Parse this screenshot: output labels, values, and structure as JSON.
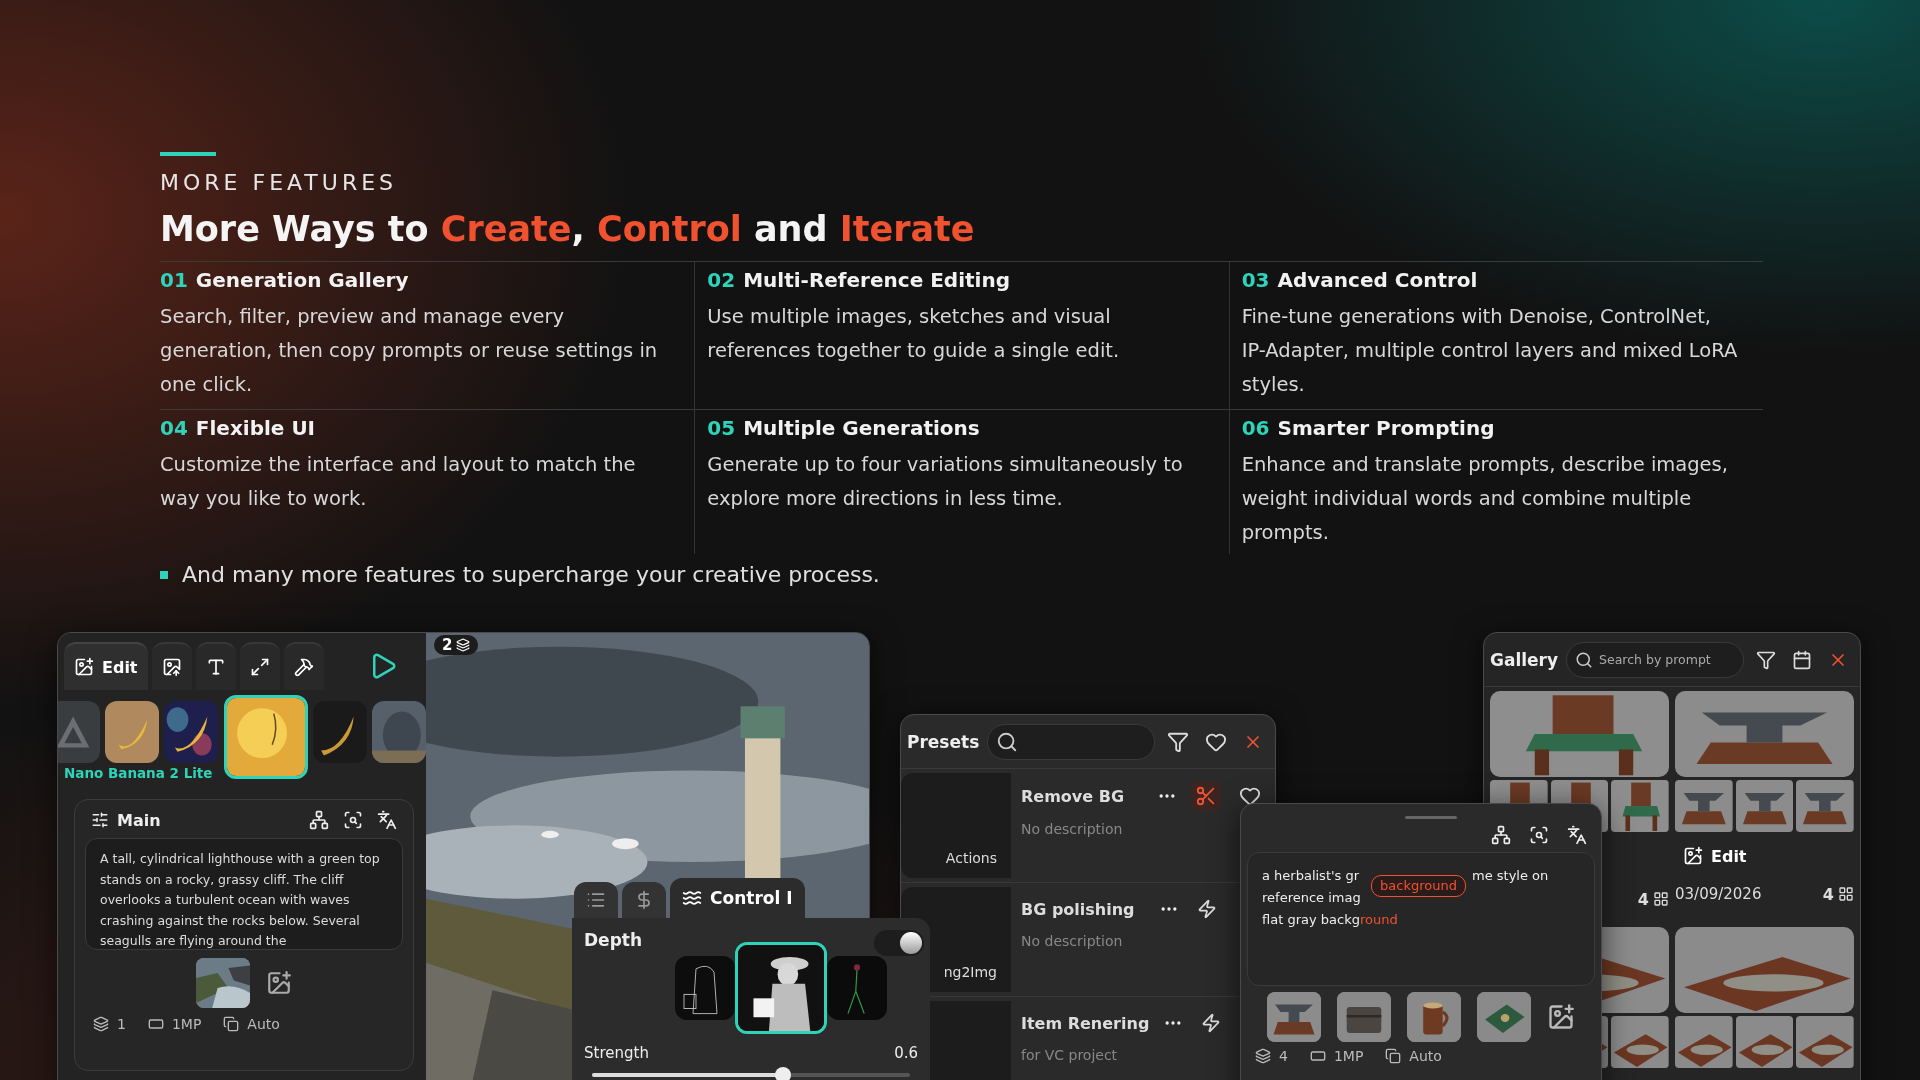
{
  "section_label": "MORE FEATURES",
  "heading": [
    {
      "text": "More Ways to ",
      "accent": false
    },
    {
      "text": "Create",
      "accent": true
    },
    {
      "text": ", ",
      "accent": false
    },
    {
      "text": "Control",
      "accent": true
    },
    {
      "text": " and ",
      "accent": false
    },
    {
      "text": "Iterate",
      "accent": true
    }
  ],
  "features": [
    {
      "number": "01",
      "title": "Generation Gallery",
      "description": "Search, filter, preview and manage every generation, then copy prompts or reuse settings in one click."
    },
    {
      "number": "02",
      "title": "Multi-Reference Editing",
      "description": "Use multiple images, sketches and visual references together to guide a single edit."
    },
    {
      "number": "03",
      "title": "Advanced Control",
      "description": "Fine-tune generations with Denoise, ControlNet, IP-Adapter, multiple control layers and mixed LoRA styles."
    },
    {
      "number": "04",
      "title": "Flexible UI",
      "description": "Customize the interface and layout to match the way you like to work."
    },
    {
      "number": "05",
      "title": "Multiple Generations",
      "description": "Generate up to four variations simultaneously to explore more directions in less time."
    },
    {
      "number": "06",
      "title": "Smarter Prompting",
      "description": "Enhance and translate prompts, describe images, weight individual words and combine multiple prompts."
    }
  ],
  "footnote": "And many more features to supercharge your creative process.",
  "editor": {
    "tools": [
      {
        "label": "Edit",
        "selected": true
      },
      {
        "selected": false
      },
      {
        "selected": false
      },
      {
        "selected": false
      },
      {
        "selected": false
      }
    ],
    "models": [
      {
        "selected": false
      },
      {
        "selected": false
      },
      {
        "selected": false
      },
      {
        "selected": true
      },
      {
        "selected": false
      },
      {
        "selected": false
      }
    ],
    "model_name": "Nano Banana 2 Lite",
    "prompt_panel": {
      "title": "Main",
      "text": "A tall, cylindrical lighthouse with a green top stands on a rocky, grassy cliff. The cliff overlooks a turbulent ocean with waves crashing against the rocks below. Several seagulls are flying around the",
      "settings": [
        "1",
        "1MP",
        "Auto"
      ]
    },
    "canvas_badge": "2"
  },
  "control": {
    "tabs": [
      {
        "selected": false
      },
      {
        "selected": false
      },
      {
        "label": "Control I",
        "selected": true
      }
    ],
    "title": "Depth",
    "on": true,
    "previews": [
      {
        "selected": false
      },
      {
        "selected": true
      },
      {
        "selected": false
      }
    ],
    "slider_label": "Strength",
    "value": "0.6",
    "level": 0.6
  },
  "presets": {
    "title": "Presets",
    "items": [
      {
        "category": "Actions",
        "name": "Remove BG",
        "description": "No description",
        "kind": "cut"
      },
      {
        "category": "ng2Img",
        "name": "BG polishing",
        "description": "No description",
        "kind": "bolt"
      },
      {
        "name": "Item Renering",
        "description": "for VC project",
        "kind": "bolt"
      }
    ]
  },
  "prompt_popover": {
    "lines": [
      {
        "left": "a herbalist's gr",
        "right": "me style on"
      },
      {
        "left": "reference imag"
      },
      {
        "left": "flat gray backg",
        "highlight": "round"
      }
    ],
    "tag": "background",
    "references": [
      {
        "kind": "picture"
      },
      {
        "kind": "picture"
      },
      {
        "kind": "picture"
      },
      {
        "kind": "picture"
      }
    ],
    "settings": [
      "4",
      "1MP",
      "Auto"
    ]
  },
  "gallery": {
    "title": "Gallery",
    "search_placeholder": "Search by prompt",
    "cards": [
      {
        "count": "4"
      },
      {
        "date": "03/09/2026",
        "count": "4",
        "action": "Edit"
      }
    ],
    "more_cards": [
      {
        "kind": "picture"
      },
      {
        "kind": "picture"
      }
    ]
  }
}
